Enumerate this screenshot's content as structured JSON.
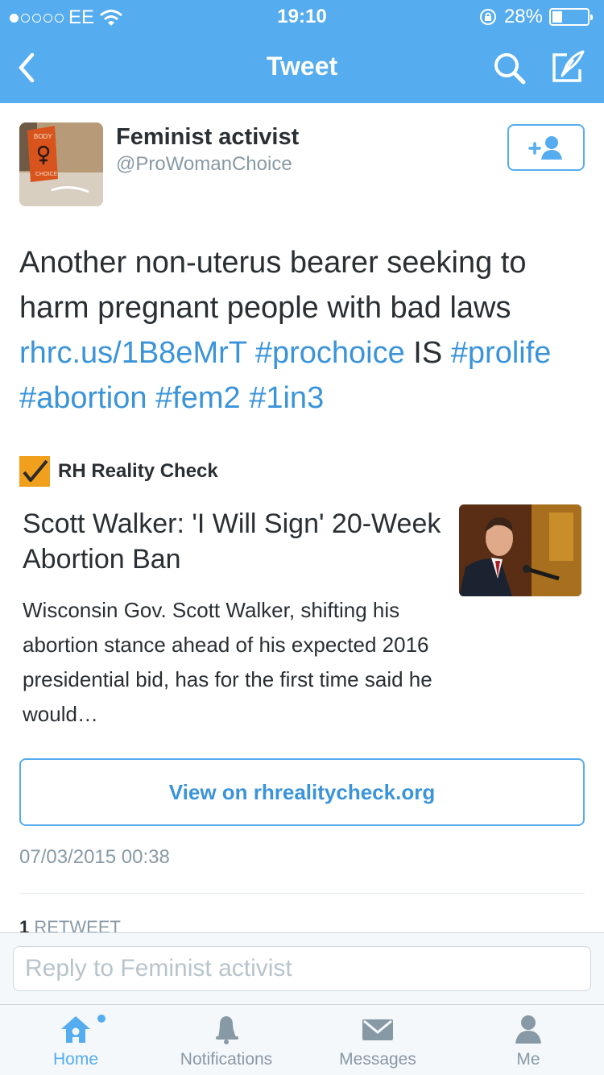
{
  "status_bar": {
    "carrier": "EE",
    "time": "19:10",
    "battery": "28%",
    "battery_level": 0.28
  },
  "nav": {
    "title": "Tweet",
    "icons": [
      "back-chevron-icon",
      "search-icon",
      "compose-icon"
    ]
  },
  "tweet": {
    "author_name": "Feminist activist",
    "author_handle": "@ProWomanChoice",
    "text_plain_1": "Another non-uterus bearer seeking to harm pregnant people with bad laws ",
    "link_url": "rhrc.us/1B8eMrT",
    "hashtag_1": "#prochoice",
    "text_plain_2": " IS ",
    "hashtag_2": "#prolife",
    "hashtag_3": "#abortion",
    "hashtag_4": "#fem2",
    "hashtag_5": "#1in3",
    "timestamp": "07/03/2015 00:38",
    "retweet_count": "1",
    "retweet_label": "RETWEET"
  },
  "card": {
    "source_name": "RH Reality Check",
    "title": "Scott Walker: 'I Will Sign' 20-Week Abortion Ban",
    "description": "Wisconsin Gov. Scott Walker, shifting his abortion stance ahead of his expected 2016 presidential bid, has for the first time said he would…",
    "view_button": "View on rhrealitycheck.org"
  },
  "reply": {
    "placeholder": "Reply to Feminist activist",
    "value": ""
  },
  "tabs": [
    {
      "label": "Home",
      "icon": "home-icon",
      "active": true
    },
    {
      "label": "Notifications",
      "icon": "bell-icon",
      "active": false
    },
    {
      "label": "Messages",
      "icon": "envelope-icon",
      "active": false
    },
    {
      "label": "Me",
      "icon": "person-icon",
      "active": false
    }
  ],
  "colors": {
    "brand": "#55acee",
    "link": "#3b94d9",
    "text": "#292f33",
    "muted": "#8899a6"
  }
}
